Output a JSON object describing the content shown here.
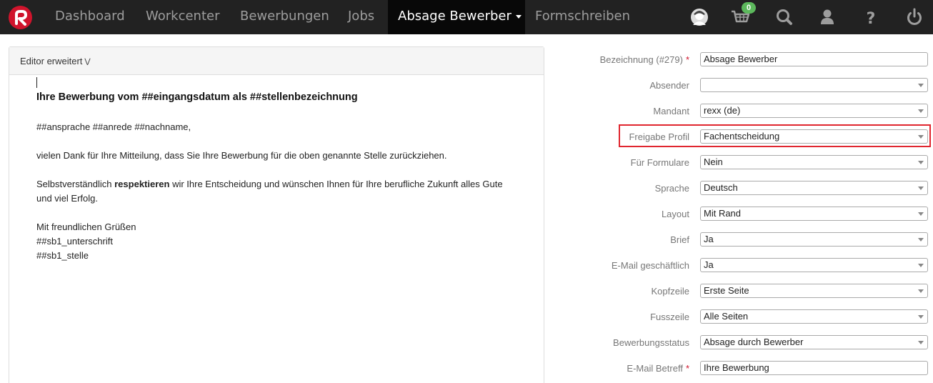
{
  "nav": {
    "items": [
      {
        "label": "Dashboard"
      },
      {
        "label": "Workcenter"
      },
      {
        "label": "Bewerbungen"
      },
      {
        "label": "Jobs"
      },
      {
        "label": "Absage Bewerber"
      },
      {
        "label": "Formschreiben"
      }
    ],
    "cart_count": "0",
    "icons": [
      "avatar-icon",
      "cart-icon",
      "search-icon",
      "user-icon",
      "help-icon",
      "power-icon"
    ],
    "colors": {
      "brand": "#d0142c",
      "navbar": "#222222",
      "active": "#080808",
      "badge": "#5cb85c"
    }
  },
  "editor": {
    "header_label": "Editor erweitert",
    "title": "Ihre Bewerbung vom ##eingangsdatum als ##stellenbezeichnung",
    "line_salutation": "##ansprache ##anrede ##nachname,",
    "line_thanks": "vielen Dank für Ihre Mitteilung, dass Sie Ihre Bewerbung für die oben genannte Stelle zurückziehen.",
    "line_respect_pre": "Selbstverständlich ",
    "line_respect_bold": "respektieren",
    "line_respect_post": " wir Ihre Entscheidung und wünschen Ihnen für Ihre berufliche Zukunft alles Gute",
    "line_respect_cont": "und viel Erfolg.",
    "closing": "Mit freundlichen Grüßen",
    "signature": "##sb1_unterschrift",
    "position": "##sb1_stelle"
  },
  "form": {
    "fields": [
      {
        "label": "Bezeichnung (#279)",
        "value": "Absage Bewerber"
      },
      {
        "label": "Absender",
        "value": ""
      },
      {
        "label": "Mandant",
        "value": "rexx (de)"
      },
      {
        "label": "Freigabe Profil",
        "value": "Fachentscheidung"
      },
      {
        "label": "Für Formulare",
        "value": "Nein"
      },
      {
        "label": "Sprache",
        "value": "Deutsch"
      },
      {
        "label": "Layout",
        "value": "Mit Rand"
      },
      {
        "label": "Brief",
        "value": "Ja"
      },
      {
        "label": "E-Mail geschäftlich",
        "value": "Ja"
      },
      {
        "label": "Kopfzeile",
        "value": "Erste Seite"
      },
      {
        "label": "Fusszeile",
        "value": "Alle Seiten"
      },
      {
        "label": "Bewerbungsstatus",
        "value": "Absage durch Bewerber"
      },
      {
        "label": "E-Mail Betreff",
        "value": "Ihre Bewerbung"
      }
    ],
    "required_marker": "*",
    "highlight_color": "#e0262f"
  }
}
